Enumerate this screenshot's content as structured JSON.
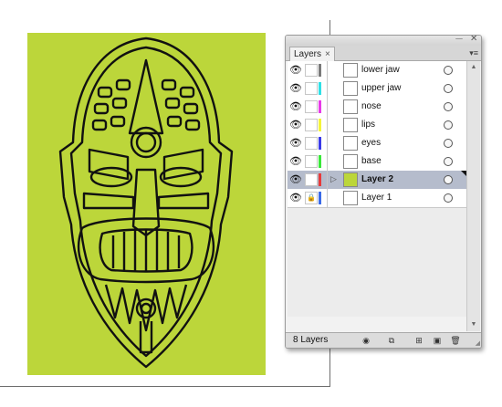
{
  "canvas": {
    "artwork_color": "#bcd63a",
    "stroke_color": "#111111"
  },
  "panel": {
    "tab_label": "Layers",
    "close_glyph": "×",
    "collapse_glyph": "⏤",
    "window_close_glyph": "✕",
    "menu_glyph": "▾≡",
    "layers": [
      {
        "name": "lower jaw",
        "color": "#7a7a7a",
        "locked": false,
        "selected": false,
        "bold": false
      },
      {
        "name": "upper jaw",
        "color": "#2fe0e6",
        "locked": false,
        "selected": false,
        "bold": false
      },
      {
        "name": "nose",
        "color": "#e83ae8",
        "locked": false,
        "selected": false,
        "bold": false
      },
      {
        "name": "lips",
        "color": "#f5f53a",
        "locked": false,
        "selected": false,
        "bold": false
      },
      {
        "name": "eyes",
        "color": "#3a3ae8",
        "locked": false,
        "selected": false,
        "bold": false
      },
      {
        "name": "base",
        "color": "#3ae83a",
        "locked": false,
        "selected": false,
        "bold": false
      },
      {
        "name": "Layer 2",
        "color": "#e83a3a",
        "locked": false,
        "selected": true,
        "bold": true
      },
      {
        "name": "Layer 1",
        "color": "#3a6ae8",
        "locked": true,
        "selected": false,
        "bold": false
      }
    ],
    "visibility_glyph": "👁",
    "lock_glyph": "🔒",
    "disclosure_glyph": "▷",
    "footer": {
      "count_label": "8 Layers",
      "icons": [
        "locate-object-icon",
        "make-clipping-mask-icon",
        "new-sublayer-icon",
        "new-layer-icon",
        "trash-icon"
      ]
    }
  }
}
